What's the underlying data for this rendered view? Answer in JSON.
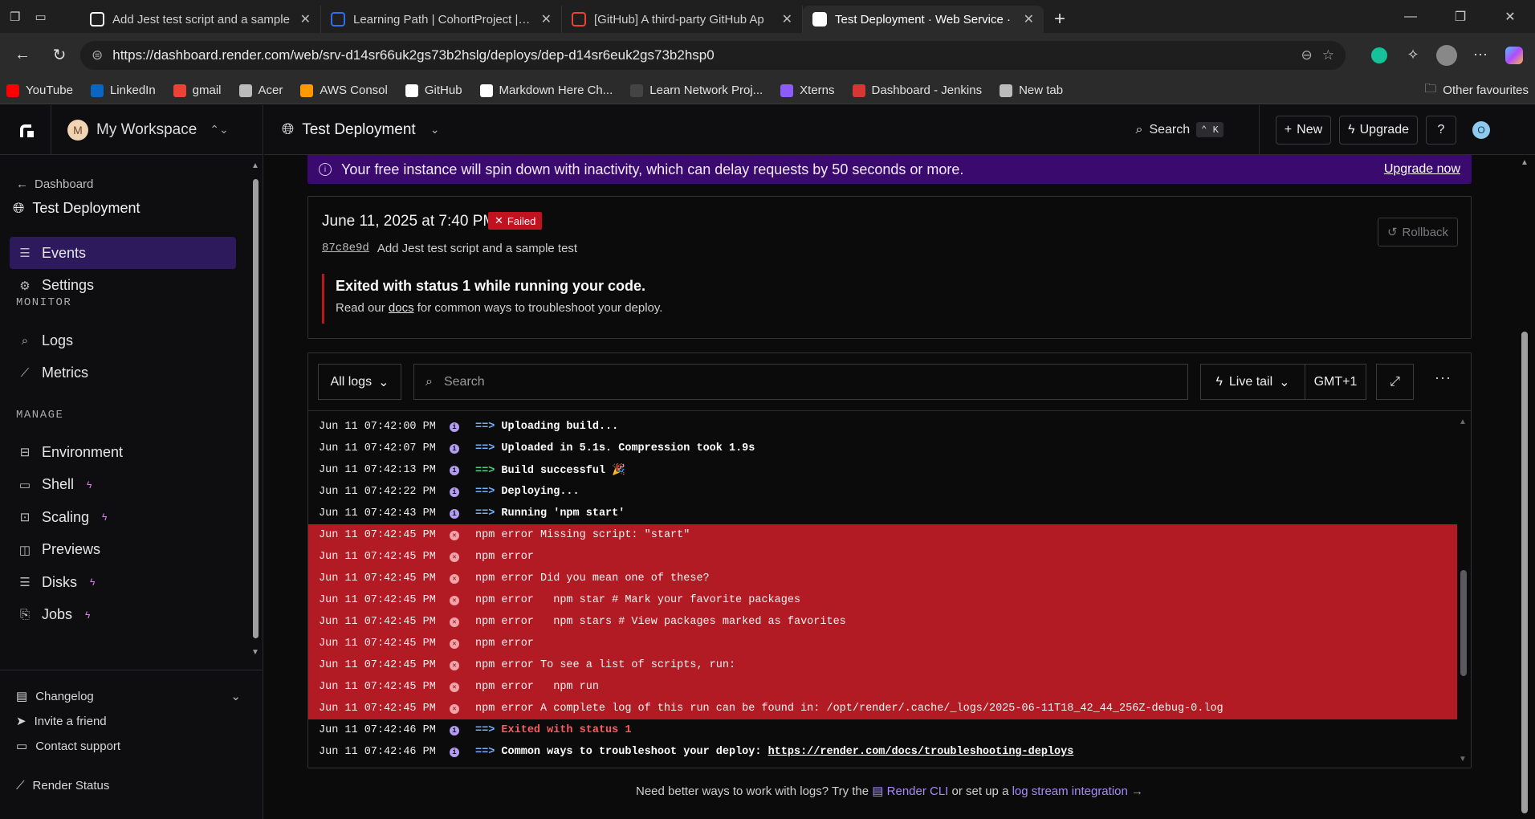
{
  "browser": {
    "tabs": [
      {
        "title": "Add Jest test script and a sample",
        "favicon": "github-icon",
        "active": false
      },
      {
        "title": "Learning Path | CohortProject | Da",
        "favicon": "cohort-icon",
        "active": false
      },
      {
        "title": "[GitHub] A third-party GitHub Ap",
        "favicon": "gmail-icon",
        "active": false
      },
      {
        "title": "Test Deployment · Web Service ·",
        "favicon": "render-icon",
        "active": true
      }
    ],
    "url": "https://dashboard.render.com/web/srv-d14sr66uk2gs73b2hslg/deploys/dep-d14sr6euk2gs73b2hsp0",
    "bookmarks": [
      {
        "label": "YouTube",
        "icon": "youtube-icon",
        "color": "#ff0000"
      },
      {
        "label": "LinkedIn",
        "icon": "linkedin-icon",
        "color": "#0a66c2"
      },
      {
        "label": "gmail",
        "icon": "gmail-icon",
        "color": "#ea4335"
      },
      {
        "label": "Acer",
        "icon": "folder-icon",
        "color": "#bbbbbb"
      },
      {
        "label": "AWS Consol",
        "icon": "aws-icon",
        "color": "#ff9900"
      },
      {
        "label": "GitHub",
        "icon": "github-icon",
        "color": "#ffffff"
      },
      {
        "label": "Markdown Here Ch...",
        "icon": "github-icon",
        "color": "#ffffff"
      },
      {
        "label": "Learn Network Proj...",
        "icon": "globe-icon",
        "color": "#444444"
      },
      {
        "label": "Xterns",
        "icon": "xterns-icon",
        "color": "#8b5cf6"
      },
      {
        "label": "Dashboard - Jenkins",
        "icon": "jenkins-icon",
        "color": "#d33833"
      },
      {
        "label": "New tab",
        "icon": "newtab-icon",
        "color": "#bbbbbb"
      }
    ],
    "other_favourites": "Other favourites"
  },
  "sidebar": {
    "workspace_initial": "M",
    "workspace_name": "My Workspace",
    "back_label": "Dashboard",
    "service_name": "Test Deployment",
    "nav_main": [
      {
        "label": "Events",
        "icon": "list-icon",
        "active": true
      },
      {
        "label": "Settings",
        "icon": "gear-icon",
        "active": false
      }
    ],
    "monitor_label": "MONITOR",
    "nav_monitor": [
      {
        "label": "Logs",
        "icon": "logs-icon"
      },
      {
        "label": "Metrics",
        "icon": "chart-icon"
      }
    ],
    "manage_label": "MANAGE",
    "nav_manage": [
      {
        "label": "Environment",
        "icon": "environment-icon",
        "bolt": false
      },
      {
        "label": "Shell",
        "icon": "shell-icon",
        "bolt": true
      },
      {
        "label": "Scaling",
        "icon": "scaling-icon",
        "bolt": true
      },
      {
        "label": "Previews",
        "icon": "previews-icon",
        "bolt": false
      },
      {
        "label": "Disks",
        "icon": "disks-icon",
        "bolt": true
      },
      {
        "label": "Jobs",
        "icon": "jobs-icon",
        "bolt": true
      }
    ],
    "footer": {
      "changelog": "Changelog",
      "invite": "Invite a friend",
      "contact": "Contact support",
      "status": "Render Status"
    }
  },
  "header": {
    "service": "Test Deployment",
    "search": "Search",
    "shortcut": "⌃ K",
    "new_label": "New",
    "upgrade_label": "Upgrade",
    "user_initial": "O"
  },
  "banner": {
    "text": "Your free instance will spin down with inactivity, which can delay requests by 50 seconds or more.",
    "link": "Upgrade now"
  },
  "deploy": {
    "date": "June 11, 2025 at 7:40 PM",
    "status": "Failed",
    "commit_hash": "87c8e9d",
    "commit_message": "Add Jest test script and a sample test",
    "rollback": "Rollback",
    "error_title": "Exited with status 1 while running your code.",
    "error_pre": "Read our",
    "error_link": "docs",
    "error_post": "for common ways to troubleshoot your deploy."
  },
  "logs": {
    "filter": "All logs",
    "search_placeholder": "Search",
    "live_tail": "Live tail",
    "timezone": "GMT+1",
    "lines": [
      {
        "ts": "Jun 11 07:42:00 PM",
        "level": "info",
        "arrow": "==>",
        "arrow_color": "blue",
        "text": "Uploading build...",
        "style": "bold"
      },
      {
        "ts": "Jun 11 07:42:07 PM",
        "level": "info",
        "arrow": "==>",
        "arrow_color": "blue",
        "text": "Uploaded in 5.1s. Compression took 1.9s",
        "style": "bold"
      },
      {
        "ts": "Jun 11 07:42:13 PM",
        "level": "info",
        "arrow": "==>",
        "arrow_color": "green",
        "text": "Build successful 🎉",
        "style": "bold"
      },
      {
        "ts": "Jun 11 07:42:22 PM",
        "level": "info",
        "arrow": "==>",
        "arrow_color": "blue",
        "text": "Deploying...",
        "style": "bold"
      },
      {
        "ts": "Jun 11 07:42:43 PM",
        "level": "info",
        "arrow": "==>",
        "arrow_color": "blue",
        "text": "Running 'npm start'",
        "style": "bold"
      },
      {
        "ts": "Jun 11 07:42:45 PM",
        "level": "error",
        "arrow": "",
        "text": "npm error Missing script: \"start\"",
        "style": "plain"
      },
      {
        "ts": "Jun 11 07:42:45 PM",
        "level": "error",
        "arrow": "",
        "text": "npm error",
        "style": "plain"
      },
      {
        "ts": "Jun 11 07:42:45 PM",
        "level": "error",
        "arrow": "",
        "text": "npm error Did you mean one of these?",
        "style": "plain"
      },
      {
        "ts": "Jun 11 07:42:45 PM",
        "level": "error",
        "arrow": "",
        "text": "npm error   npm star # Mark your favorite packages",
        "style": "plain"
      },
      {
        "ts": "Jun 11 07:42:45 PM",
        "level": "error",
        "arrow": "",
        "text": "npm error   npm stars # View packages marked as favorites",
        "style": "plain"
      },
      {
        "ts": "Jun 11 07:42:45 PM",
        "level": "error",
        "arrow": "",
        "text": "npm error",
        "style": "plain"
      },
      {
        "ts": "Jun 11 07:42:45 PM",
        "level": "error",
        "arrow": "",
        "text": "npm error To see a list of scripts, run:",
        "style": "plain"
      },
      {
        "ts": "Jun 11 07:42:45 PM",
        "level": "error",
        "arrow": "",
        "text": "npm error   npm run",
        "style": "plain"
      },
      {
        "ts": "Jun 11 07:42:45 PM",
        "level": "error",
        "arrow": "",
        "text": "npm error A complete log of this run can be found in: /opt/render/.cache/_logs/2025-06-11T18_42_44_256Z-debug-0.log",
        "style": "plain"
      },
      {
        "ts": "Jun 11 07:42:46 PM",
        "level": "info",
        "arrow": "==>",
        "arrow_color": "blue",
        "text": "Exited with status 1",
        "style": "red"
      },
      {
        "ts": "Jun 11 07:42:46 PM",
        "level": "info",
        "arrow": "==>",
        "arrow_color": "blue",
        "text": "Common ways to troubleshoot your deploy: ",
        "link": "https://render.com/docs/troubleshooting-deploys",
        "style": "bold"
      }
    ]
  },
  "footer_note": {
    "pre": "Need better ways to work with logs? Try the",
    "cli": "Render CLI",
    "mid": "or set up a",
    "stream": "log stream integration →"
  },
  "colors": {
    "accent": "#2d1a5c",
    "banner": "#3b0a6e",
    "error_row": "#b31b24",
    "failed_badge": "#c1121f"
  }
}
